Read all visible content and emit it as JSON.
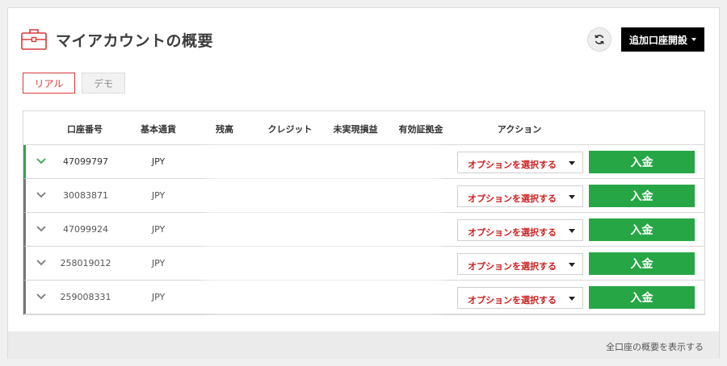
{
  "header": {
    "title": "マイアカウントの概要",
    "open_account_label": "追加口座開設"
  },
  "tabs": [
    {
      "label": "リアル",
      "active": true
    },
    {
      "label": "デモ",
      "active": false
    }
  ],
  "table": {
    "columns": [
      "口座番号",
      "基本通貨",
      "残高",
      "クレジット",
      "未実現損益",
      "有効証拠金",
      "アクション"
    ],
    "rows": [
      {
        "account": "47099797",
        "currency": "JPY",
        "active": true
      },
      {
        "account": "30083871",
        "currency": "JPY",
        "active": false
      },
      {
        "account": "47099924",
        "currency": "JPY",
        "active": false
      },
      {
        "account": "258019012",
        "currency": "JPY",
        "active": false
      },
      {
        "account": "259008331",
        "currency": "JPY",
        "active": false
      }
    ],
    "select_label": "オプションを選択する",
    "deposit_label": "入金"
  },
  "footer": {
    "link_label": "全口座の概要を表示する"
  },
  "colors": {
    "accent_red": "#d93a3a",
    "deposit_green": "#27a646",
    "active_row_border": "#2ea84a"
  },
  "icons": {
    "briefcase": "briefcase-icon",
    "refresh": "refresh-icon",
    "chevron": "chevron-down-icon"
  }
}
